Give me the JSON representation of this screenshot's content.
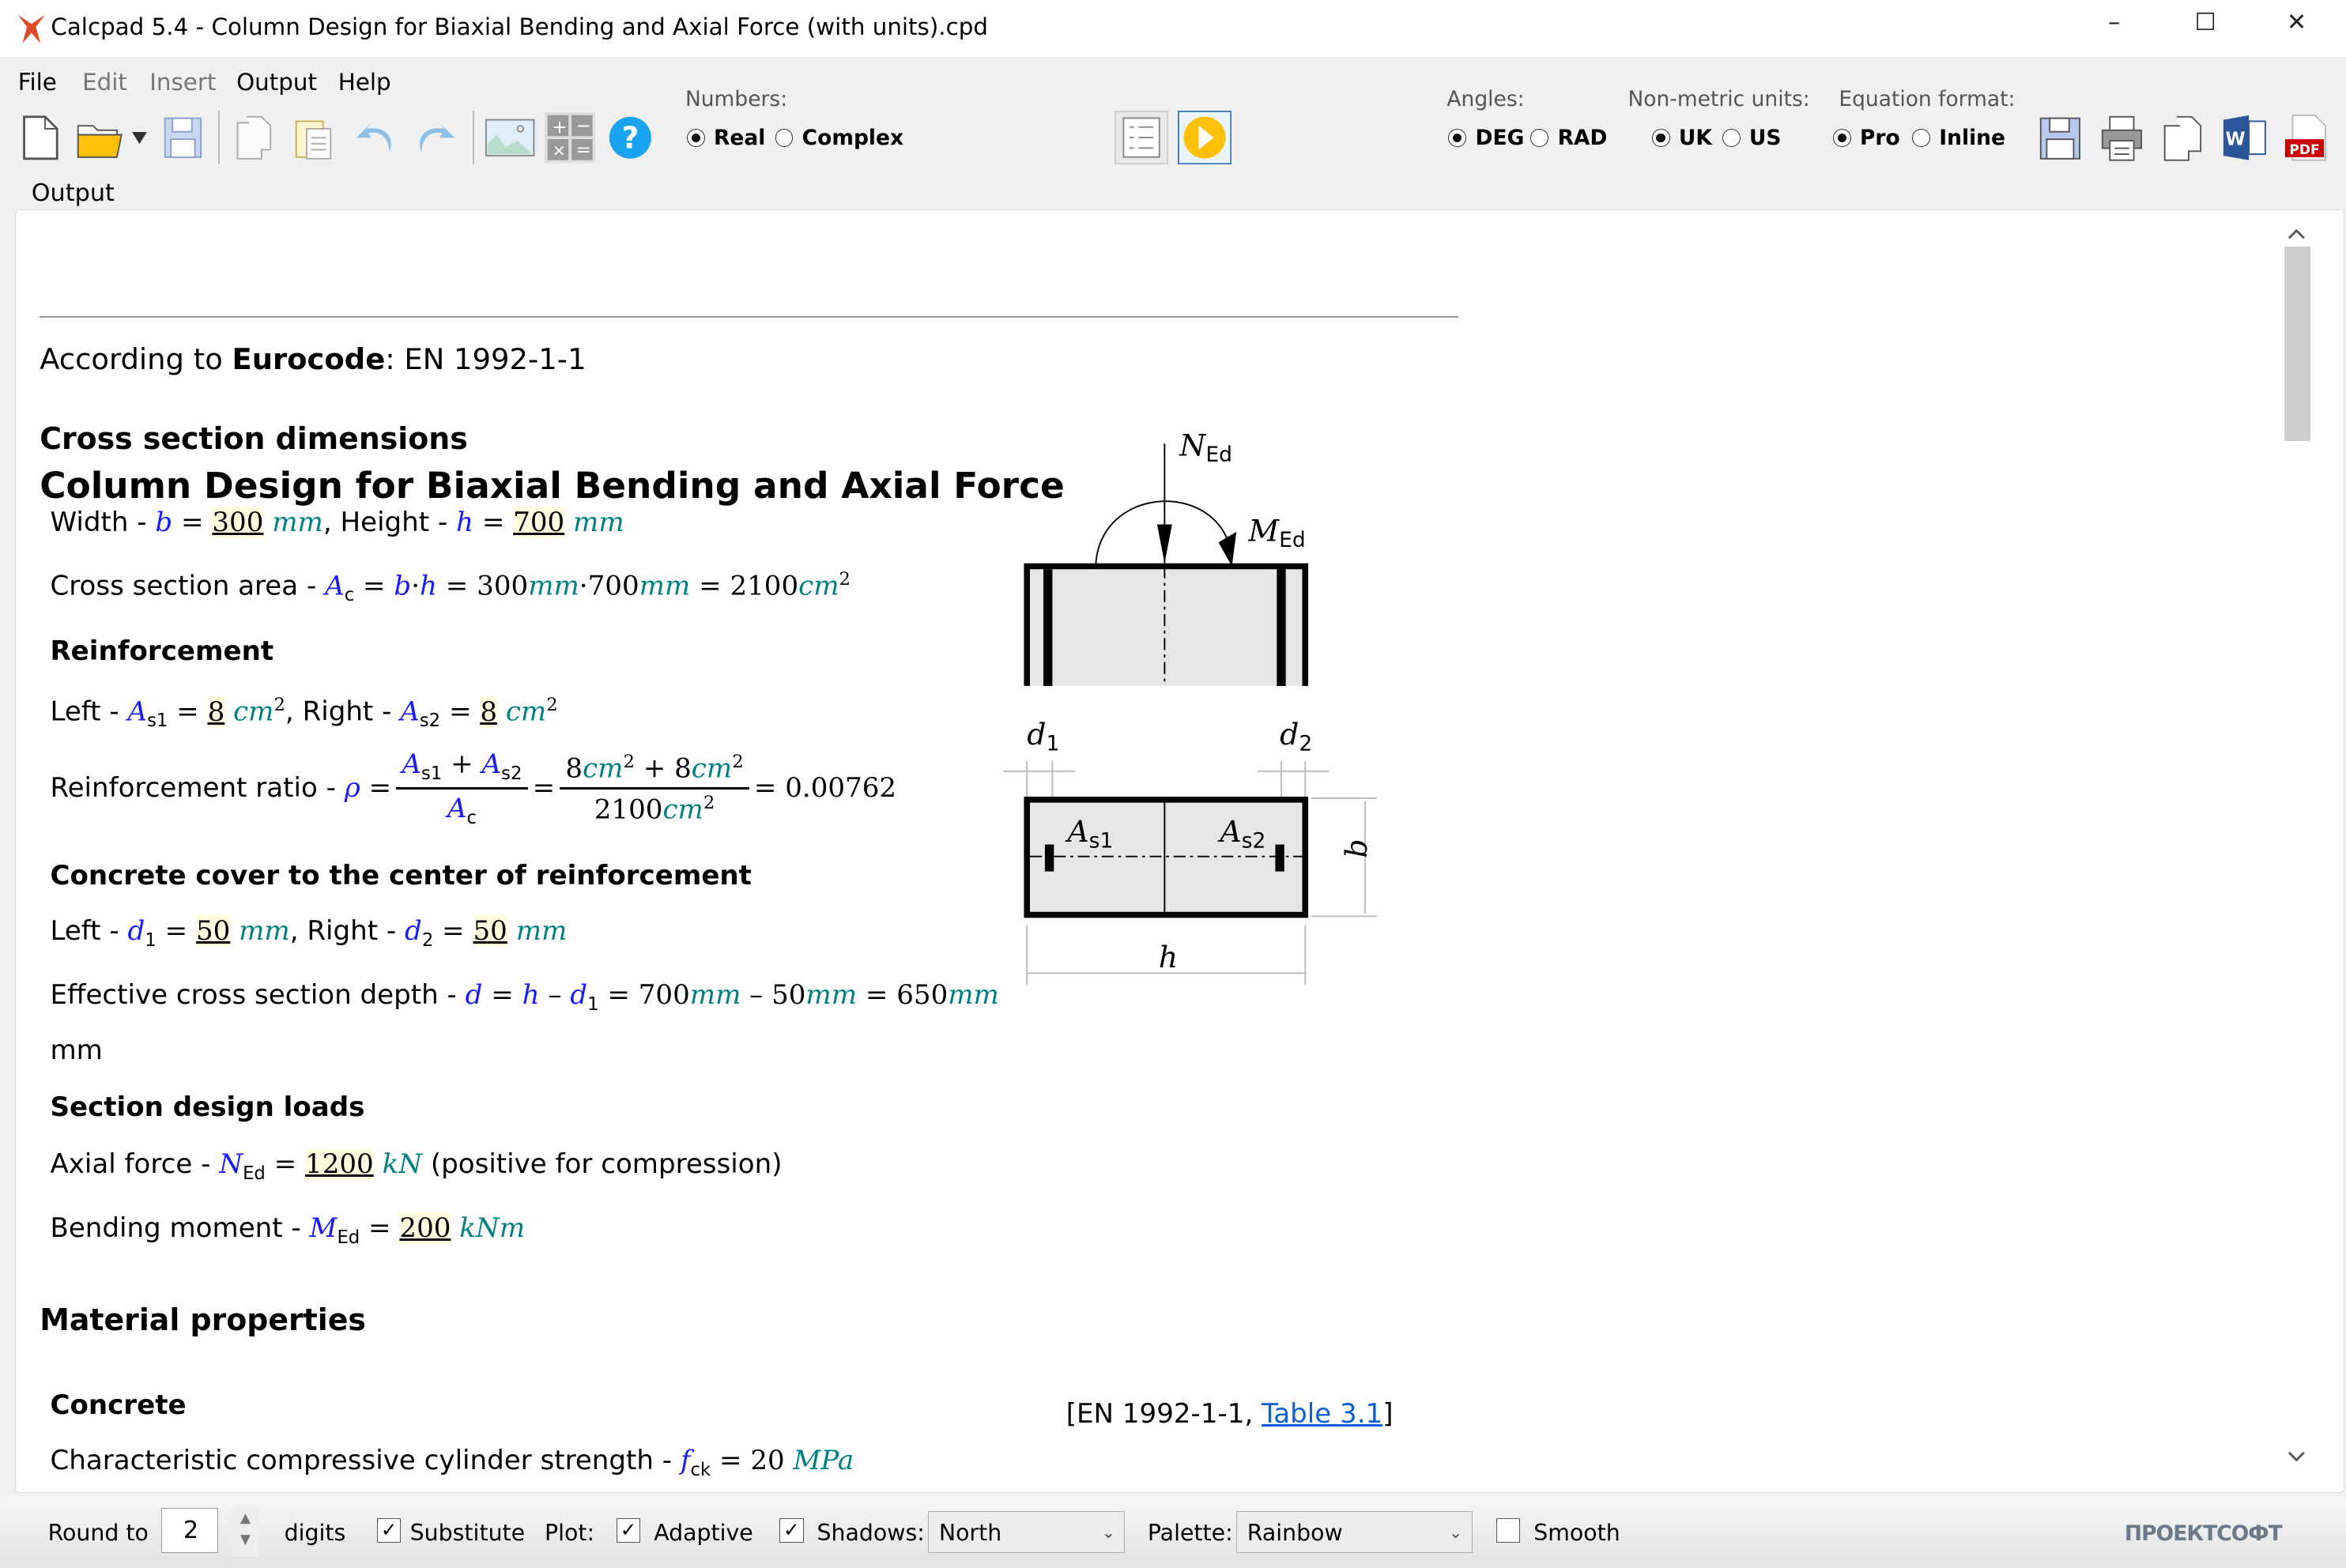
{
  "window": {
    "title": "Calcpad 5.4 - Column Design for Biaxial Bending and Axial Force (with units).cpd",
    "minimize": "–",
    "maximize": "☐",
    "close": "✕"
  },
  "menu": [
    "File",
    "Edit",
    "Insert",
    "Output",
    "Help"
  ],
  "toolbar": {
    "icons": [
      "new-file-icon",
      "open-folder-icon",
      "save-icon",
      "copy-icon",
      "paste-icon",
      "undo-icon",
      "redo-icon",
      "image-icon",
      "calculator-icon",
      "help-icon",
      "form-view-icon",
      "run-icon"
    ],
    "numbers_label": "Numbers:",
    "numbers_options": [
      "Real",
      "Complex"
    ],
    "numbers_selected": "Real",
    "angles_label": "Angles:",
    "angles_options": [
      "DEG",
      "RAD"
    ],
    "angles_selected": "DEG",
    "units_label": "Non-metric units:",
    "units_options": [
      "UK",
      "US"
    ],
    "units_selected": "UK",
    "eqformat_label": "Equation format:",
    "eqformat_options": [
      "Pro",
      "Inline"
    ],
    "eqformat_selected": "Pro",
    "export_icons": [
      "save-html-icon",
      "print-icon",
      "copy-output-icon",
      "word-icon",
      "pdf-icon"
    ],
    "pdf_text": "PDF",
    "word_text": "W"
  },
  "output": {
    "panel_label": "Output",
    "title": "Column Design for Biaxial Bending and Axial Force",
    "according_pre": "According to ",
    "according_bold": "Eurocode",
    "according_post": ": EN 1992-1-1",
    "sec_cross": "Cross section dimensions",
    "width_label": "Width - ",
    "b": "b",
    "eq": "=",
    "b_val": "300",
    "mm": "mm",
    "height_label": ", Height - ",
    "h": "h",
    "h_val": "700",
    "area_label": "Cross section area - ",
    "A": "A",
    "c": "c",
    "dot": "·",
    "area_calc1": "300",
    "area_calc2": "700",
    "area_res": "2100",
    "cm": "cm",
    "sq": "2",
    "reinf": "Reinforcement",
    "left_label": "Left - ",
    "s1": "s1",
    "s2": "s2",
    "As1_val": "8",
    "right_label": ", Right - ",
    "As2_val": "8",
    "ratio_label": "Reinforcement ratio - ",
    "rho": "ρ",
    "plus": "+",
    "eight": "8",
    "ratio_res": "0.00762",
    "cover": "Concrete cover to the center of reinforcement",
    "d": "d",
    "one": "1",
    "two": "2",
    "d1_val": "50",
    "d2_val": "50",
    "eff_label": "Effective cross section depth - ",
    "minus": "–",
    "eff_a": "700",
    "eff_b": "50",
    "eff_res": "650",
    "eff_tail": "mm",
    "loads": "Section design loads",
    "axial_label": "Axial force - ",
    "N": "N",
    "Ed": "Ed",
    "N_val": "1200",
    "kN": "kN",
    "axial_note": " (positive for compression)",
    "moment_label": "Bending moment - ",
    "M": "M",
    "M_val": "200",
    "kNm": "kNm",
    "sec_mat": "Material properties",
    "concrete": "Concrete",
    "ref_pre": "[EN 1992-1-1, ",
    "ref_link": "Table 3.1",
    "ref_post": "]",
    "fck_label": "Characteristic compressive cylinder strength - ",
    "f": "f",
    "ck": "ck",
    "fck_val": "20",
    "MPa": "MPa"
  },
  "diagram": {
    "N_label": "N",
    "N_sub": "Ed",
    "M_label": "M",
    "M_sub": "Ed",
    "d1": "d",
    "d1_sub": "1",
    "d2": "d",
    "d2_sub": "2",
    "As1": "A",
    "As1_sub": "s1",
    "As2": "A",
    "As2_sub": "s2",
    "b": "b",
    "h": "h"
  },
  "statusbar": {
    "round_label": "Round to",
    "round_value": "2",
    "digits_label": "digits",
    "substitute_label": "Substitute",
    "substitute_checked": true,
    "plot_label": "Plot:",
    "adaptive_label": "Adaptive",
    "adaptive_checked": true,
    "shadows_label": "Shadows:",
    "shadows_checked": true,
    "shadows_value": "North",
    "palette_label": "Palette:",
    "palette_value": "Rainbow",
    "smooth_label": "Smooth",
    "smooth_checked": false,
    "logo": "ПРОЕКТСОФТ",
    "check": "✓",
    "arrow": "⌄"
  },
  "colors": {
    "variable": "#1a1aff",
    "unit": "#008080",
    "input_bg": "#ffffe0",
    "run_button": "#ffc107",
    "help": "#1aa3f0"
  }
}
